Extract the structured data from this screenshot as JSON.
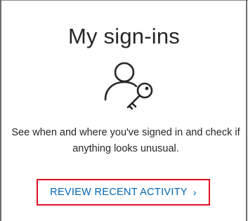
{
  "card": {
    "title": "My sign-ins",
    "description": "See when and where you've signed in and check if anything looks unusual.",
    "action_label": "REVIEW RECENT ACTIVITY",
    "action_chevron": "›"
  },
  "icons": {
    "main_icon": "person-key-icon",
    "action_icon": "chevron-right-icon"
  },
  "colors": {
    "link": "#0067b8",
    "highlight_outline": "#e01020",
    "text": "#262626"
  }
}
